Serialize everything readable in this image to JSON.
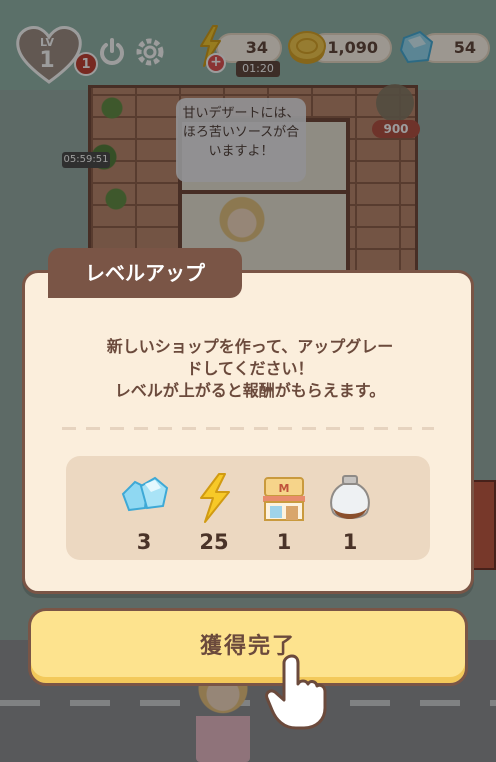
{
  "hud": {
    "level_label": "LV",
    "level": "1",
    "level_badge": "1",
    "energy": "34",
    "energy_timer": "01:20",
    "energy_plus": "+",
    "coins": "1,090",
    "gems": "54"
  },
  "scene": {
    "speech": "甘いデザートには、ほろ苦いソースが合いますよ！",
    "side_price": "900",
    "side_timer": "05:59:51"
  },
  "modal": {
    "title": "レベルアップ",
    "message_line1": "新しいショップを作って、アップグレー",
    "message_line2": "ドしてください！",
    "message_line3": "レベルが上がると報酬がもらえます。",
    "rewards": [
      {
        "icon": "gem-icon",
        "qty": "3"
      },
      {
        "icon": "energy-icon",
        "qty": "25"
      },
      {
        "icon": "shop-icon",
        "qty": "1"
      },
      {
        "icon": "jar-icon",
        "qty": "1"
      }
    ],
    "claim_label": "獲得完了"
  },
  "colors": {
    "modal_bg": "#fbeedc",
    "modal_border": "#7a5546",
    "button_bg": "#fde38e",
    "text_brown": "#6b4a3c"
  }
}
